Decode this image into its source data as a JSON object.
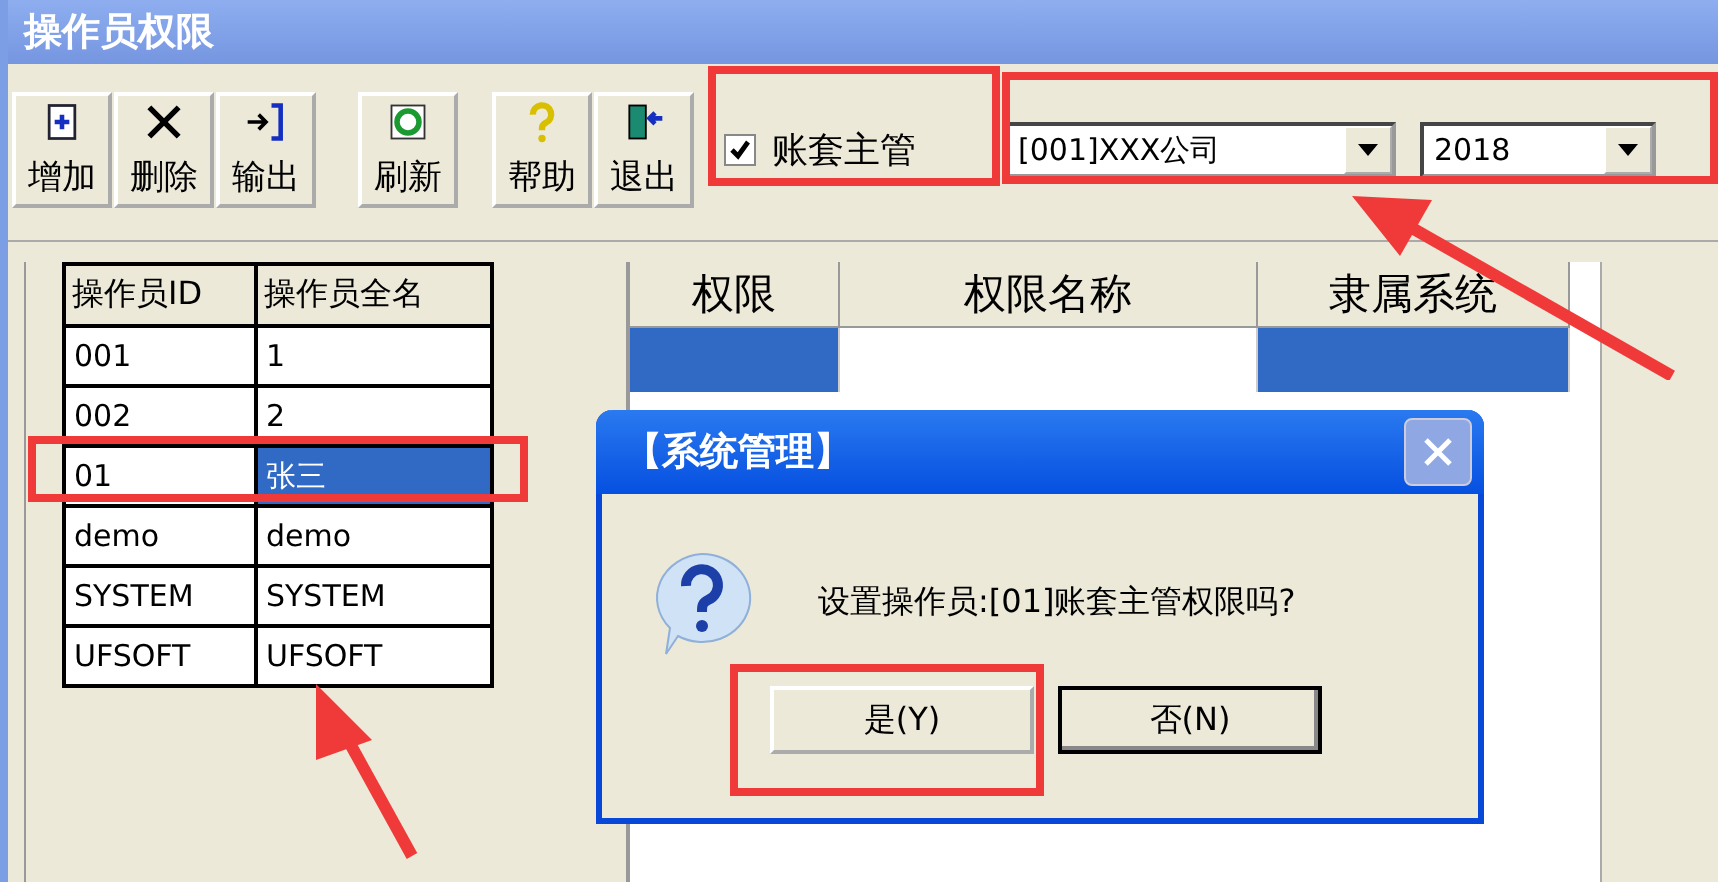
{
  "window": {
    "title": "操作员权限"
  },
  "toolbar": [
    {
      "label": "增加",
      "kind": "add"
    },
    {
      "label": "删除",
      "kind": "delete"
    },
    {
      "label": "输出",
      "kind": "export"
    },
    {
      "label": "刷新",
      "kind": "refresh"
    },
    {
      "label": "帮助",
      "kind": "help"
    },
    {
      "label": "退出",
      "kind": "exit"
    }
  ],
  "master_checkbox": {
    "label": "账套主管",
    "checked": true
  },
  "account_dropdown": {
    "value": "[001]XXX公司"
  },
  "year_dropdown": {
    "value": "2018"
  },
  "operators": {
    "columns": [
      "操作员ID",
      "操作员全名"
    ],
    "rows": [
      {
        "cells": [
          "001",
          "1"
        ],
        "selected": false
      },
      {
        "cells": [
          "002",
          "2"
        ],
        "selected": false
      },
      {
        "cells": [
          "01",
          "张三"
        ],
        "selected": true
      },
      {
        "cells": [
          "demo",
          "demo"
        ],
        "selected": false
      },
      {
        "cells": [
          "SYSTEM",
          "SYSTEM"
        ],
        "selected": false
      },
      {
        "cells": [
          "UFSOFT",
          "UFSOFT"
        ],
        "selected": false
      }
    ]
  },
  "permissions": {
    "columns": [
      "权限",
      "权限名称",
      "隶属系统"
    ],
    "rows": [
      {
        "selected": true
      }
    ]
  },
  "dialog": {
    "title": "【系统管理】",
    "message": "设置操作员:[01]账套主管权限吗?",
    "buttons": [
      {
        "label": "是(Y)",
        "default": false
      },
      {
        "label": "否(N)",
        "default": true
      }
    ]
  }
}
